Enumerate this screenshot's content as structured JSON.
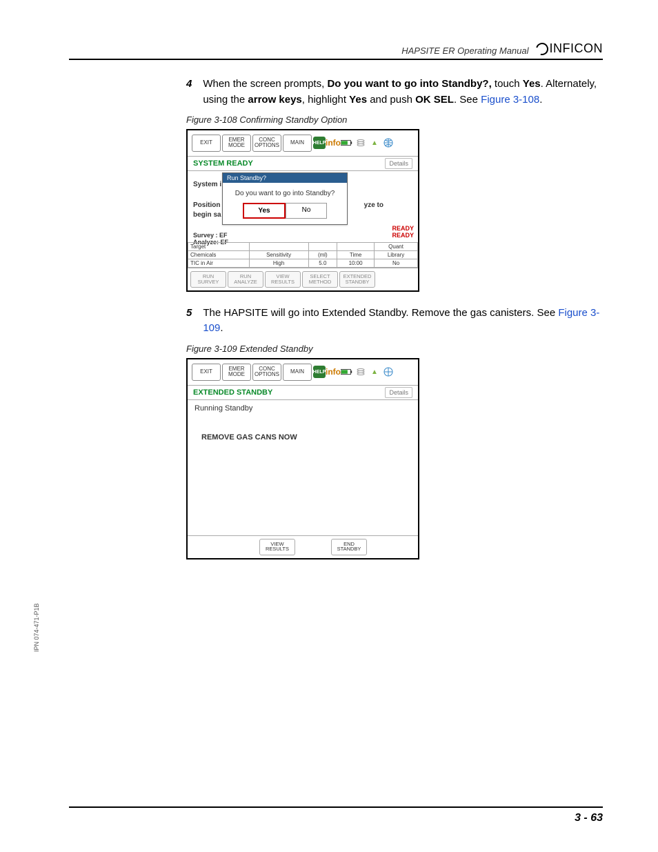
{
  "header": {
    "manual_title": "HAPSITE ER Operating Manual",
    "brand": "INFICON"
  },
  "steps": [
    {
      "num": "4",
      "segments": [
        {
          "t": "plain",
          "v": "When the screen prompts, "
        },
        {
          "t": "bold",
          "v": "Do you want to go into Standby?,"
        },
        {
          "t": "plain",
          "v": " touch "
        },
        {
          "t": "bold",
          "v": "Yes"
        },
        {
          "t": "plain",
          "v": ". Alternately, using the "
        },
        {
          "t": "bold",
          "v": "arrow keys"
        },
        {
          "t": "plain",
          "v": ", highlight "
        },
        {
          "t": "bold",
          "v": "Yes"
        },
        {
          "t": "plain",
          "v": " and push "
        },
        {
          "t": "bold",
          "v": "OK SEL"
        },
        {
          "t": "plain",
          "v": ". See "
        },
        {
          "t": "link",
          "v": "Figure 3-108"
        },
        {
          "t": "plain",
          "v": "."
        }
      ]
    },
    {
      "num": "5",
      "segments": [
        {
          "t": "plain",
          "v": "The HAPSITE will go into Extended Standby. Remove the gas canisters. See "
        },
        {
          "t": "link",
          "v": "Figure 3-109"
        },
        {
          "t": "plain",
          "v": "."
        }
      ]
    }
  ],
  "figures": {
    "f108": {
      "caption": "Figure 3-108  Confirming Standby Option"
    },
    "f109": {
      "caption": "Figure 3-109  Extended Standby"
    }
  },
  "device1": {
    "toolbar": {
      "exit": "EXIT",
      "emer_l1": "EMER",
      "emer_l2": "MODE",
      "conc_l1": "CONC",
      "conc_l2": "OPTIONS",
      "main": "MAIN",
      "help": "HELP",
      "info": "info"
    },
    "status": {
      "left": "SYSTEM READY",
      "details": "Details"
    },
    "bg": {
      "system": "System i:",
      "position": "Position",
      "begin": "begin sa",
      "yze": "yze to",
      "survey": "Survey : EF",
      "analyze": "Analyze: EF"
    },
    "dialog": {
      "title": "Run Standby?",
      "prompt": "Do you want to go into Standby?",
      "yes": "Yes",
      "no": "No"
    },
    "ready": {
      "r1": "READY",
      "r2": "READY"
    },
    "table": {
      "h1": "Target",
      "h2": "",
      "h3": "",
      "h4": "",
      "h5": "Quant",
      "r1c1": "Chemicals",
      "r1c2": "Sensitivity",
      "r1c3": "(ml)",
      "r1c4": "Time",
      "r1c5": "Library",
      "r2c1": "TIC in Air",
      "r2c2": "High",
      "r2c3": "5.0",
      "r2c4": "10:00",
      "r2c5": "No"
    },
    "footer": {
      "b1l1": "RUN",
      "b1l2": "SURVEY",
      "b2l1": "RUN",
      "b2l2": "ANALYZE",
      "b3l1": "VIEW",
      "b3l2": "RESULTS",
      "b4l1": "SELECT",
      "b4l2": "METHOD",
      "b5l1": "EXTENDED",
      "b5l2": "STANDBY"
    }
  },
  "device2": {
    "status_left": "EXTENDED STANDBY",
    "details": "Details",
    "running": "Running Standby",
    "remove": "REMOVE GAS CANS NOW",
    "footer": {
      "view_l1": "VIEW",
      "view_l2": "RESULTS",
      "end_l1": "END",
      "end_l2": "STANDBY"
    }
  },
  "side_note": "IPN 074-471-P1B",
  "page_number": "3 - 63"
}
